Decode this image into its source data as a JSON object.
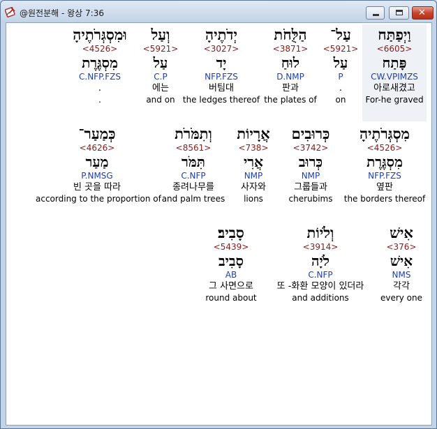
{
  "window": {
    "title": "@원전분해 - 왕상 7:36",
    "icon": "cross-book-icon",
    "controls": {
      "minimize": "minimize-icon",
      "maximize": "maximize-icon",
      "close": "close-icon"
    }
  },
  "colors": {
    "strong": "#8b1a1a",
    "morph": "#1c3fb4",
    "text": "#000000"
  },
  "rows": [
    {
      "words": [
        {
          "hebrew": "וַיְפַתַּח",
          "strong": "<6605>",
          "lemma": "פָּתַח",
          "morph": "CW.VPIMZS",
          "korean": "아로새겼고",
          "english": "For-he graved",
          "selected": true
        },
        {
          "hebrew": "עַל־",
          "strong": "<5921>",
          "lemma": "עַל",
          "morph": "P",
          "korean": ".",
          "english": "on"
        },
        {
          "hebrew": "הַלֻּחֹת",
          "strong": "<3871>",
          "lemma": "לוּחַ",
          "morph": "D.NMP",
          "korean": "판과",
          "english": "the plates of"
        },
        {
          "hebrew": "יְדֹתֶיהָ",
          "strong": "<3027>",
          "lemma": "יָד",
          "morph": "NFP.FZS",
          "korean": "버팀대",
          "english": "the ledges thereof"
        },
        {
          "hebrew": "וְעַל",
          "strong": "<5921>",
          "lemma": "עַל",
          "morph": "C.P",
          "korean": "에는",
          "english": "and on"
        },
        {
          "hebrew": "וּמִסְגְּרֹתֶיהָ",
          "strong": "<4526>",
          "lemma": "מִסְגֶּרֶת",
          "morph": "C.NFP.FZS",
          "korean": ".",
          "english": "."
        }
      ]
    },
    {
      "words": [
        {
          "hebrew": "מִסְגְּרֹתֶיהָ",
          "strong": "<4526>",
          "lemma": "מִסְגֶּרֶת",
          "morph": "NFP.FZS",
          "korean": "옆판",
          "english": "the borders thereof"
        },
        {
          "hebrew": "כְּרוּבִים",
          "strong": "<3742>",
          "lemma": "כְּרוּב",
          "morph": "NMP",
          "korean": "그룹들과",
          "english": "cherubims"
        },
        {
          "hebrew": "אֲרָיוֹת",
          "strong": "<738>",
          "lemma": "אֲרִי",
          "morph": "NMP",
          "korean": "사자와",
          "english": "lions"
        },
        {
          "hebrew": "וְתִמֹּרֹת",
          "strong": "<8561>",
          "lemma": "תִּמֹּר",
          "morph": "C.NFP",
          "korean": "종려나무를",
          "english": "and palm trees"
        },
        {
          "hebrew": "כְּמַעַר־",
          "strong": "<4626>",
          "lemma": "מַעַר",
          "morph": "P.NMSG",
          "korean": "빈 곳을 따라",
          "english": "according to the proportion of"
        }
      ]
    },
    {
      "words": [
        {
          "hebrew": "אִישׁ",
          "strong": "<376>",
          "lemma": "אִישׁ",
          "morph": "NMS",
          "korean": "각각",
          "english": "every one"
        },
        {
          "hebrew": "וְלֹיוֹת",
          "strong": "<3914>",
          "lemma": "לֹיָה",
          "morph": "C.NFP",
          "korean": "또 -화환 모양이 있더라",
          "english": "and additions"
        },
        {
          "hebrew": "סָבִיב׃",
          "strong": "<5439>",
          "lemma": "סָבִיב",
          "morph": "AB",
          "korean": "그 사면으로",
          "english": "round about"
        }
      ]
    }
  ]
}
